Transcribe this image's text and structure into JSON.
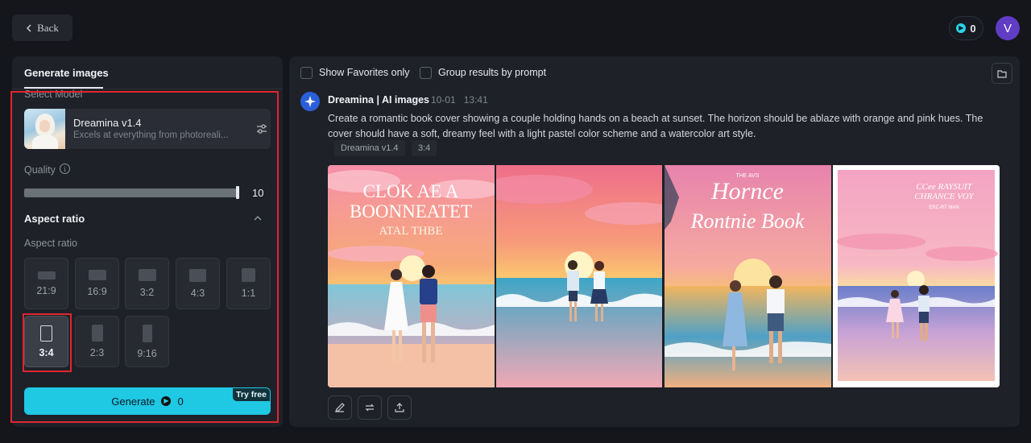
{
  "topbar": {
    "back_label": "Back",
    "credits": "0",
    "avatar_initial": "V"
  },
  "left_panel": {
    "tab_label": "Generate images",
    "select_model_label": "Select Model",
    "model": {
      "name": "Dreamina v1.4",
      "description": "Excels at everything from photoreali..."
    },
    "quality": {
      "label": "Quality",
      "value": "10",
      "fraction": 1.0
    },
    "aspect_ratio": {
      "title": "Aspect ratio",
      "subtitle": "Aspect ratio",
      "options": [
        "21:9",
        "16:9",
        "3:2",
        "4:3",
        "1:1",
        "3:4",
        "2:3",
        "9:16"
      ],
      "selected": "3:4"
    },
    "generate": {
      "label": "Generate",
      "cost": "0",
      "badge": "Try free"
    }
  },
  "right_panel": {
    "filters": {
      "favorites_label": "Show Favorites only",
      "group_label": "Group results by prompt"
    },
    "result": {
      "author": "Dreamina | AI images",
      "date": "10-01",
      "time": "13:41",
      "prompt": "Create a romantic book cover showing a couple holding hands on a beach at sunset. The horizon should be ablaze with orange and pink hues. The cover should have a soft, dreamy feel with a light pastel color scheme and a watercolor art style.",
      "tags": [
        "Dreamina v1.4",
        "3:4"
      ],
      "images": [
        {
          "title_line1": "CLOK AE A",
          "title_line2": "BOONNEATET",
          "title_line3": "ATAL THBE"
        },
        {
          "title_line1": "",
          "title_line2": "",
          "title_line3": ""
        },
        {
          "title_line1": "THE AVS",
          "title_line2": "Hornce",
          "title_line3": "Rontnie Book"
        },
        {
          "title_line1": "CCee RAYSUIT",
          "title_line2": "CHRANCE VOY",
          "title_line3": "ERC-RT MAN"
        }
      ]
    },
    "actions": [
      "edit-icon",
      "regenerate-icon",
      "export-icon"
    ]
  },
  "colors": {
    "accent": "#1fc8e3",
    "highlight_frame": "#e1252f",
    "avatar": "#5f3dc4"
  }
}
